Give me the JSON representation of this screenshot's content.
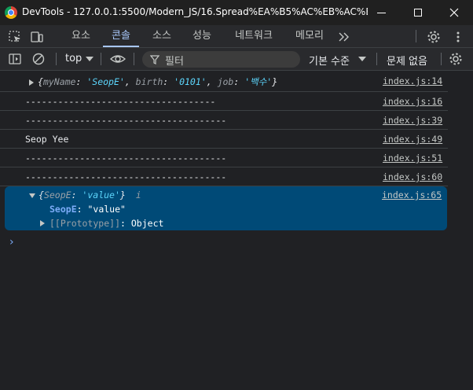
{
  "window": {
    "title": "DevTools - 127.0.0.1:5500/Modern_JS/16.Spread%EA%B5%AC%EB%AC%B8%2..."
  },
  "tabs": [
    {
      "label": "요소",
      "active": false
    },
    {
      "label": "콘솔",
      "active": true
    },
    {
      "label": "소스",
      "active": false
    },
    {
      "label": "성능",
      "active": false
    },
    {
      "label": "네트워크",
      "active": false
    },
    {
      "label": "메모리",
      "active": false
    }
  ],
  "toolbar": {
    "context": "top",
    "filter_placeholder": "필터",
    "levels": "기본 수준",
    "issues": "문제 없음"
  },
  "messages": [
    {
      "link": "index.js:14",
      "object": {
        "parts": [
          {
            "k": "myName",
            "v": "'SeopE'"
          },
          {
            "k": "birth",
            "v": "'0101'"
          },
          {
            "k": "job",
            "v": "'백수'"
          }
        ]
      }
    },
    {
      "text": "-----------------------------------",
      "link": "index.js:16"
    },
    {
      "text": "-------------------------------------",
      "link": "index.js:39"
    },
    {
      "text": "Seop Yee",
      "link": "index.js:49"
    },
    {
      "text": "-------------------------------------",
      "link": "index.js:51"
    },
    {
      "text": "-------------------------------------",
      "link": "index.js:60"
    }
  ],
  "expanded": {
    "link": "index.js:65",
    "summary_key": "SeopE",
    "summary_val": "'value'",
    "info": "i",
    "prop_key": "SeopE",
    "prop_val": "\"value\"",
    "proto_label": "[[Prototype]]",
    "proto_val": "Object"
  },
  "prompt": "›"
}
